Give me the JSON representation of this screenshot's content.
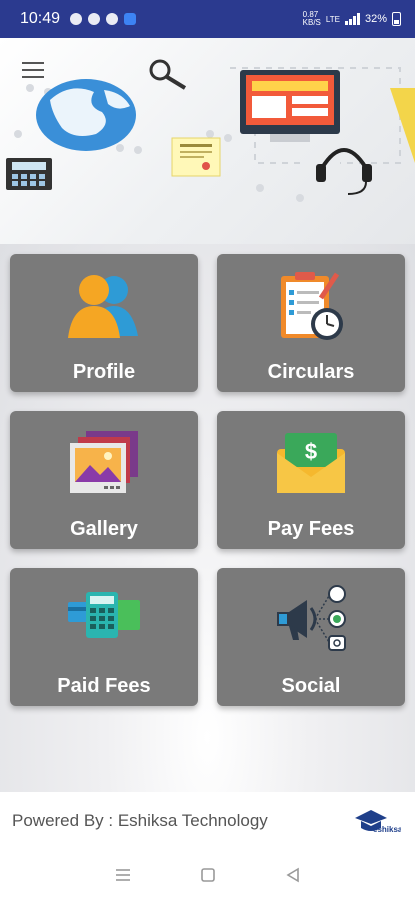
{
  "status_bar": {
    "time": "10:49",
    "speed": "0.87\nKB/S",
    "network": "LTE",
    "battery": "32%"
  },
  "header": {
    "menu_icon": "hamburger-menu-icon"
  },
  "tiles": [
    {
      "id": "profile",
      "label": "Profile",
      "icon": "profile-users-icon"
    },
    {
      "id": "circulars",
      "label": "Circulars",
      "icon": "clipboard-clock-icon"
    },
    {
      "id": "gallery",
      "label": "Gallery",
      "icon": "photo-gallery-icon"
    },
    {
      "id": "pay-fees",
      "label": "Pay Fees",
      "icon": "money-envelope-icon"
    },
    {
      "id": "paid-fees",
      "label": "Paid Fees",
      "icon": "card-calculator-icon"
    },
    {
      "id": "social",
      "label": "Social",
      "icon": "megaphone-social-icon"
    }
  ],
  "footer": {
    "powered_by": "Powered By : Eshiksa Technology",
    "logo_text": "eshiksa"
  },
  "colors": {
    "status_bar": "#2b3a8f",
    "tile_bg": "#7a7a7a",
    "tile_text": "#ffffff"
  }
}
